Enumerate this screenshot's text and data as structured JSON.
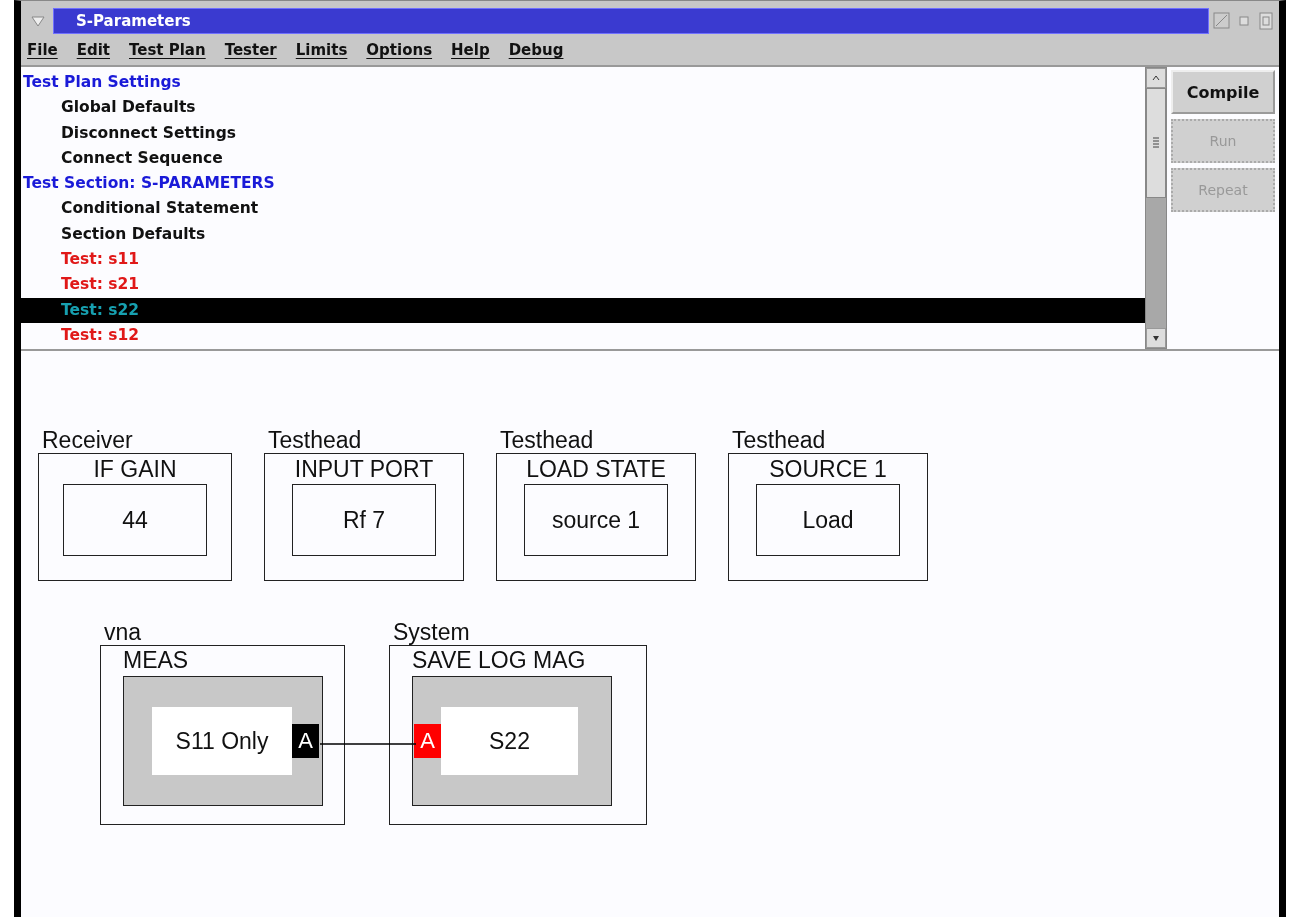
{
  "window": {
    "title": "S-Parameters"
  },
  "menu": [
    "File",
    "Edit",
    "Test Plan",
    "Tester",
    "Limits",
    "Options",
    "Help",
    "Debug"
  ],
  "tree": [
    {
      "label": "Test Plan Settings",
      "kind": "section",
      "selected": false
    },
    {
      "label": "Global Defaults",
      "kind": "item",
      "selected": false
    },
    {
      "label": "Disconnect Settings",
      "kind": "item",
      "selected": false
    },
    {
      "label": "Connect Sequence",
      "kind": "item",
      "selected": false
    },
    {
      "label": "Test Section: S-PARAMETERS",
      "kind": "section",
      "selected": false
    },
    {
      "label": "Conditional Statement",
      "kind": "item",
      "selected": false
    },
    {
      "label": "Section Defaults",
      "kind": "item",
      "selected": false
    },
    {
      "label": "Test: s11",
      "kind": "test",
      "selected": false
    },
    {
      "label": "Test: s21",
      "kind": "test",
      "selected": false
    },
    {
      "label": "Test: s22",
      "kind": "test",
      "selected": true
    },
    {
      "label": "Test: s12",
      "kind": "test",
      "selected": false
    }
  ],
  "buttons": [
    {
      "label": "Compile",
      "disabled": false
    },
    {
      "label": "Run",
      "disabled": true
    },
    {
      "label": "Repeat",
      "disabled": true
    }
  ],
  "diagram": {
    "rows": [
      [
        {
          "category": "Receiver",
          "name": "IF GAIN",
          "value": "44",
          "kind": "simple"
        },
        {
          "category": "Testhead",
          "name": "INPUT PORT",
          "value": "Rf 7",
          "kind": "simple"
        },
        {
          "category": "Testhead",
          "name": "LOAD STATE",
          "value": "source 1",
          "kind": "simple"
        },
        {
          "category": "Testhead",
          "name": "SOURCE 1",
          "value": "Load",
          "kind": "simple"
        }
      ],
      [
        {
          "category": "vna",
          "name": "MEAS",
          "value": "S11 Only",
          "kind": "measure",
          "port": {
            "label": "A",
            "kind": "output",
            "color": "#000000"
          }
        },
        {
          "category": "System",
          "name": "SAVE LOG MAG",
          "value": "S22",
          "kind": "measure",
          "port": {
            "label": "A",
            "kind": "input",
            "color": "#ff0000"
          }
        }
      ]
    ]
  }
}
